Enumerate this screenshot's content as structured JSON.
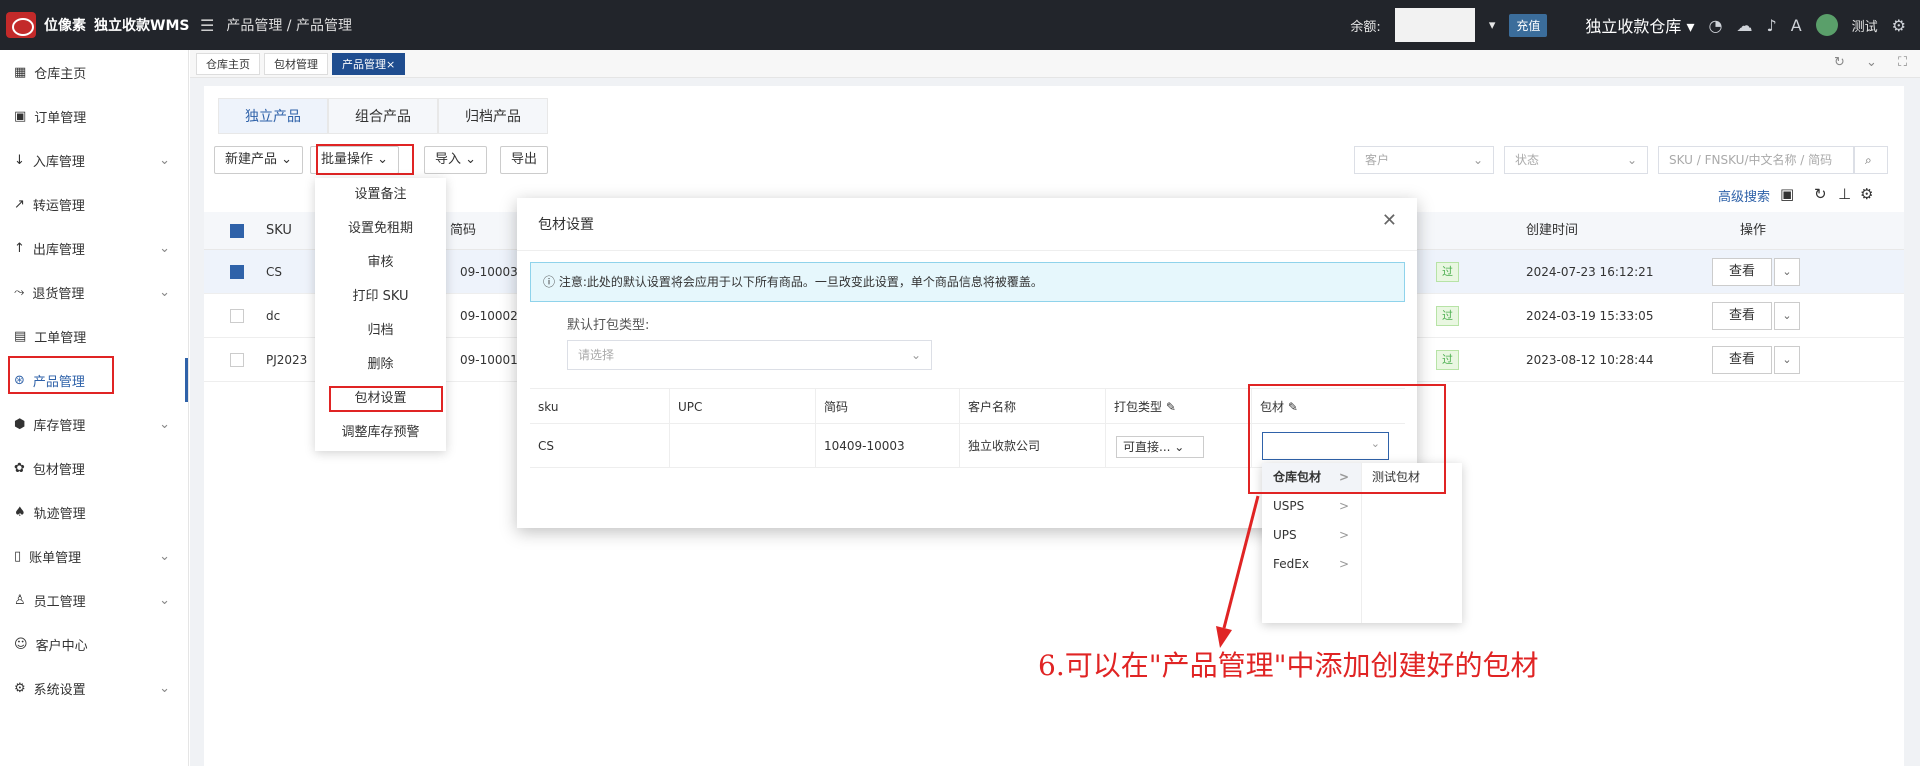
{
  "topbar": {
    "logo_name": "位像素",
    "app_name": "独立收款WMS",
    "breadcrumb": "产品管理 / 产品管理",
    "balance_label": "余额:",
    "recharge": "充值",
    "warehouse": "独立收款仓库",
    "user": "测试"
  },
  "sidebar": {
    "items": [
      {
        "icon": "▦",
        "label": "仓库主页",
        "arrow": ""
      },
      {
        "icon": "▣",
        "label": "订单管理",
        "arrow": ""
      },
      {
        "icon": "↓",
        "label": "入库管理",
        "arrow": "⌄"
      },
      {
        "icon": "↗",
        "label": "转运管理",
        "arrow": ""
      },
      {
        "icon": "↑",
        "label": "出库管理",
        "arrow": "⌄"
      },
      {
        "icon": "⤳",
        "label": "退货管理",
        "arrow": "⌄"
      },
      {
        "icon": "▤",
        "label": "工单管理",
        "arrow": ""
      },
      {
        "icon": "⊛",
        "label": "产品管理",
        "arrow": ""
      },
      {
        "icon": "⬢",
        "label": "库存管理",
        "arrow": "⌄"
      },
      {
        "icon": "✿",
        "label": "包材管理",
        "arrow": ""
      },
      {
        "icon": "♠",
        "label": "轨迹管理",
        "arrow": ""
      },
      {
        "icon": "▯",
        "label": "账单管理",
        "arrow": "⌄"
      },
      {
        "icon": "♙",
        "label": "员工管理",
        "arrow": "⌄"
      },
      {
        "icon": "☺",
        "label": "客户中心",
        "arrow": ""
      },
      {
        "icon": "⚙",
        "label": "系统设置",
        "arrow": "⌄"
      }
    ]
  },
  "page_tabs": [
    "仓库主页",
    "包材管理",
    "产品管理×"
  ],
  "sub_tabs": [
    "独立产品",
    "组合产品",
    "归档产品"
  ],
  "toolbar": {
    "new_product": "新建产品 ⌄",
    "batch": "批量操作 ⌄",
    "import": "导入 ⌄",
    "export": "导出",
    "customer_placeholder": "客户",
    "status_placeholder": "状态",
    "search_placeholder": "SKU / FNSKU/中文名称 / 简码",
    "advanced_search": "高级搜索"
  },
  "table": {
    "headers": {
      "sku": "SKU",
      "code": "简码",
      "created": "创建时间",
      "actions": "操作"
    },
    "rows": [
      {
        "sku": "CS",
        "code": "09-10003",
        "status": "过",
        "created": "2024-07-23 16:12:21",
        "view": "查看"
      },
      {
        "sku": "dc",
        "code": "09-10002",
        "status": "过",
        "created": "2024-03-19 15:33:05",
        "view": "查看"
      },
      {
        "sku": "PJ2023",
        "code": "09-10001",
        "status": "过",
        "created": "2023-08-12 10:28:44",
        "view": "查看"
      }
    ]
  },
  "batch_menu": [
    "设置备注",
    "设置免租期",
    "审核",
    "打印 SKU",
    "归档",
    "删除",
    "包材设置",
    "调整库存预警"
  ],
  "modal": {
    "title": "包材设置",
    "close": "✕",
    "notice": "ⓘ 注意:此处的默认设置将会应用于以下所有商品。一旦改变此设置，单个商品信息将被覆盖。",
    "default_pack_label": "默认打包类型:",
    "default_pack_placeholder": "请选择",
    "columns": [
      "sku",
      "UPC",
      "简码",
      "客户名称",
      "打包类型 ✎",
      "包材 ✎"
    ],
    "row": {
      "sku": "CS",
      "upc": "",
      "code": "10409-10003",
      "customer": "独立收款公司",
      "pack_type": "可直接..."
    }
  },
  "cascader": {
    "level1": [
      "仓库包材",
      "USPS",
      "UPS",
      "FedEx"
    ],
    "level2": [
      "测试包材"
    ]
  },
  "annotation": "6.可以在\"产品管理\"中添加创建好的包材"
}
